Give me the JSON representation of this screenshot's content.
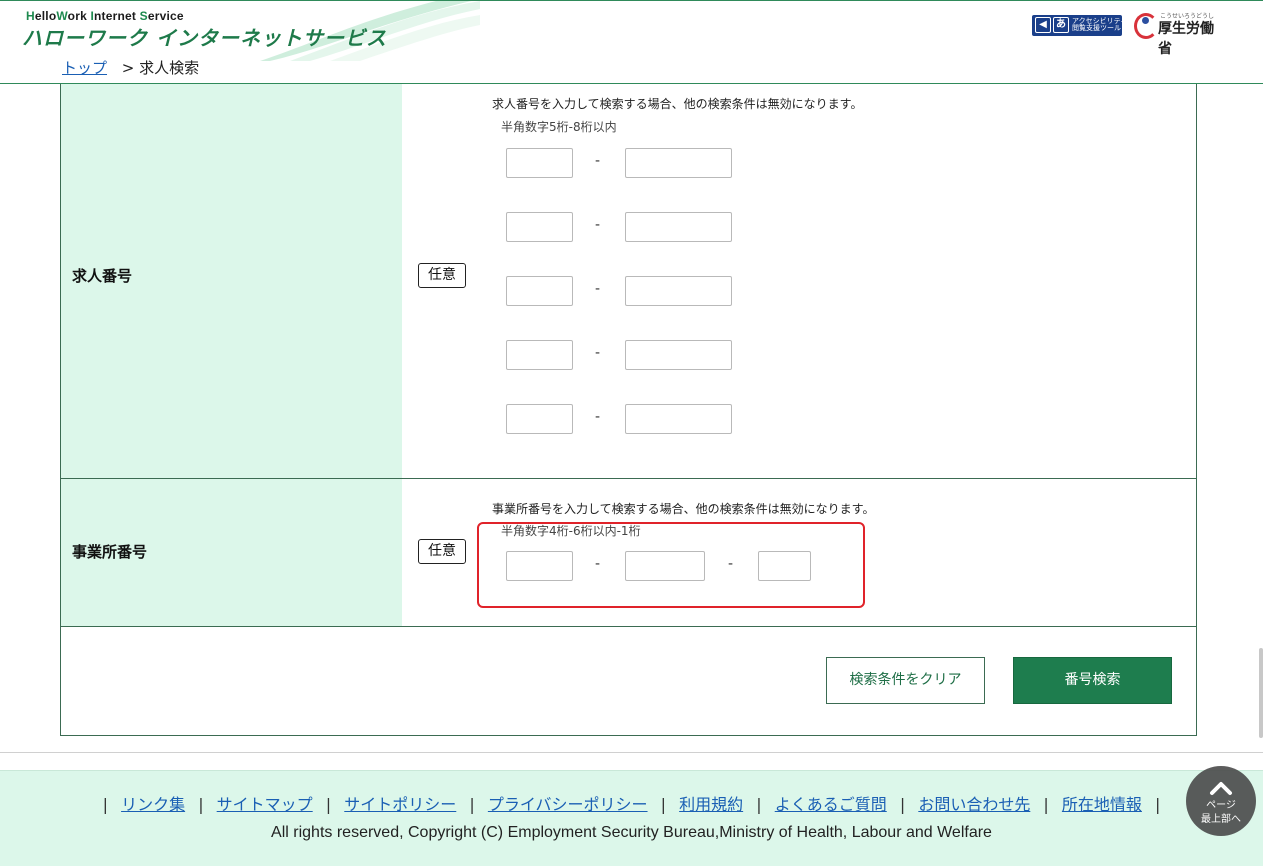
{
  "header": {
    "logo_en_parts": [
      "H",
      "ello",
      "W",
      "ork ",
      "I",
      "nternet ",
      "S",
      "ervice"
    ],
    "logo_ja": "ハローワーク インターネットサービス",
    "accessibility_tool_label": "アクセシビリティ\n閲覧支援ツール",
    "ministry_name": "厚生労働省",
    "ministry_kana": "こうせいろうどうしょう"
  },
  "breadcrumb": {
    "top_link": "トップ",
    "separator": ">",
    "current": "求人検索"
  },
  "job_number": {
    "label": "求人番号",
    "badge": "任意",
    "note": "求人番号を入力して検索する場合、他の検索条件は無効になります。",
    "hint": "半角数字5桁-8桁以内",
    "dash": "-",
    "rows": [
      {
        "first": "",
        "second": ""
      },
      {
        "first": "",
        "second": ""
      },
      {
        "first": "",
        "second": ""
      },
      {
        "first": "",
        "second": ""
      },
      {
        "first": "",
        "second": ""
      }
    ]
  },
  "office_number": {
    "label": "事業所番号",
    "badge": "任意",
    "note": "事業所番号を入力して検索する場合、他の検索条件は無効になります。",
    "hint": "半角数字4桁-6桁以内-1桁",
    "dash": "-",
    "first": "",
    "second": "",
    "third": ""
  },
  "buttons": {
    "clear": "検索条件をクリア",
    "search": "番号検索"
  },
  "footer": {
    "links": [
      "リンク集",
      "サイトマップ",
      "サイトポリシー",
      "プライバシーポリシー",
      "利用規約",
      "よくあるご質問",
      "お問い合わせ先",
      "所在地情報"
    ],
    "separator": "|",
    "copyright": "All rights reserved, Copyright (C) Employment Security Bureau,Ministry of Health, Labour and Welfare"
  },
  "page_top": {
    "line1": "ページ",
    "line2": "最上部へ"
  },
  "colors": {
    "brand_green": "#1e7d4e",
    "label_bg": "#dcf7ea",
    "highlight_red": "#e0232a"
  }
}
